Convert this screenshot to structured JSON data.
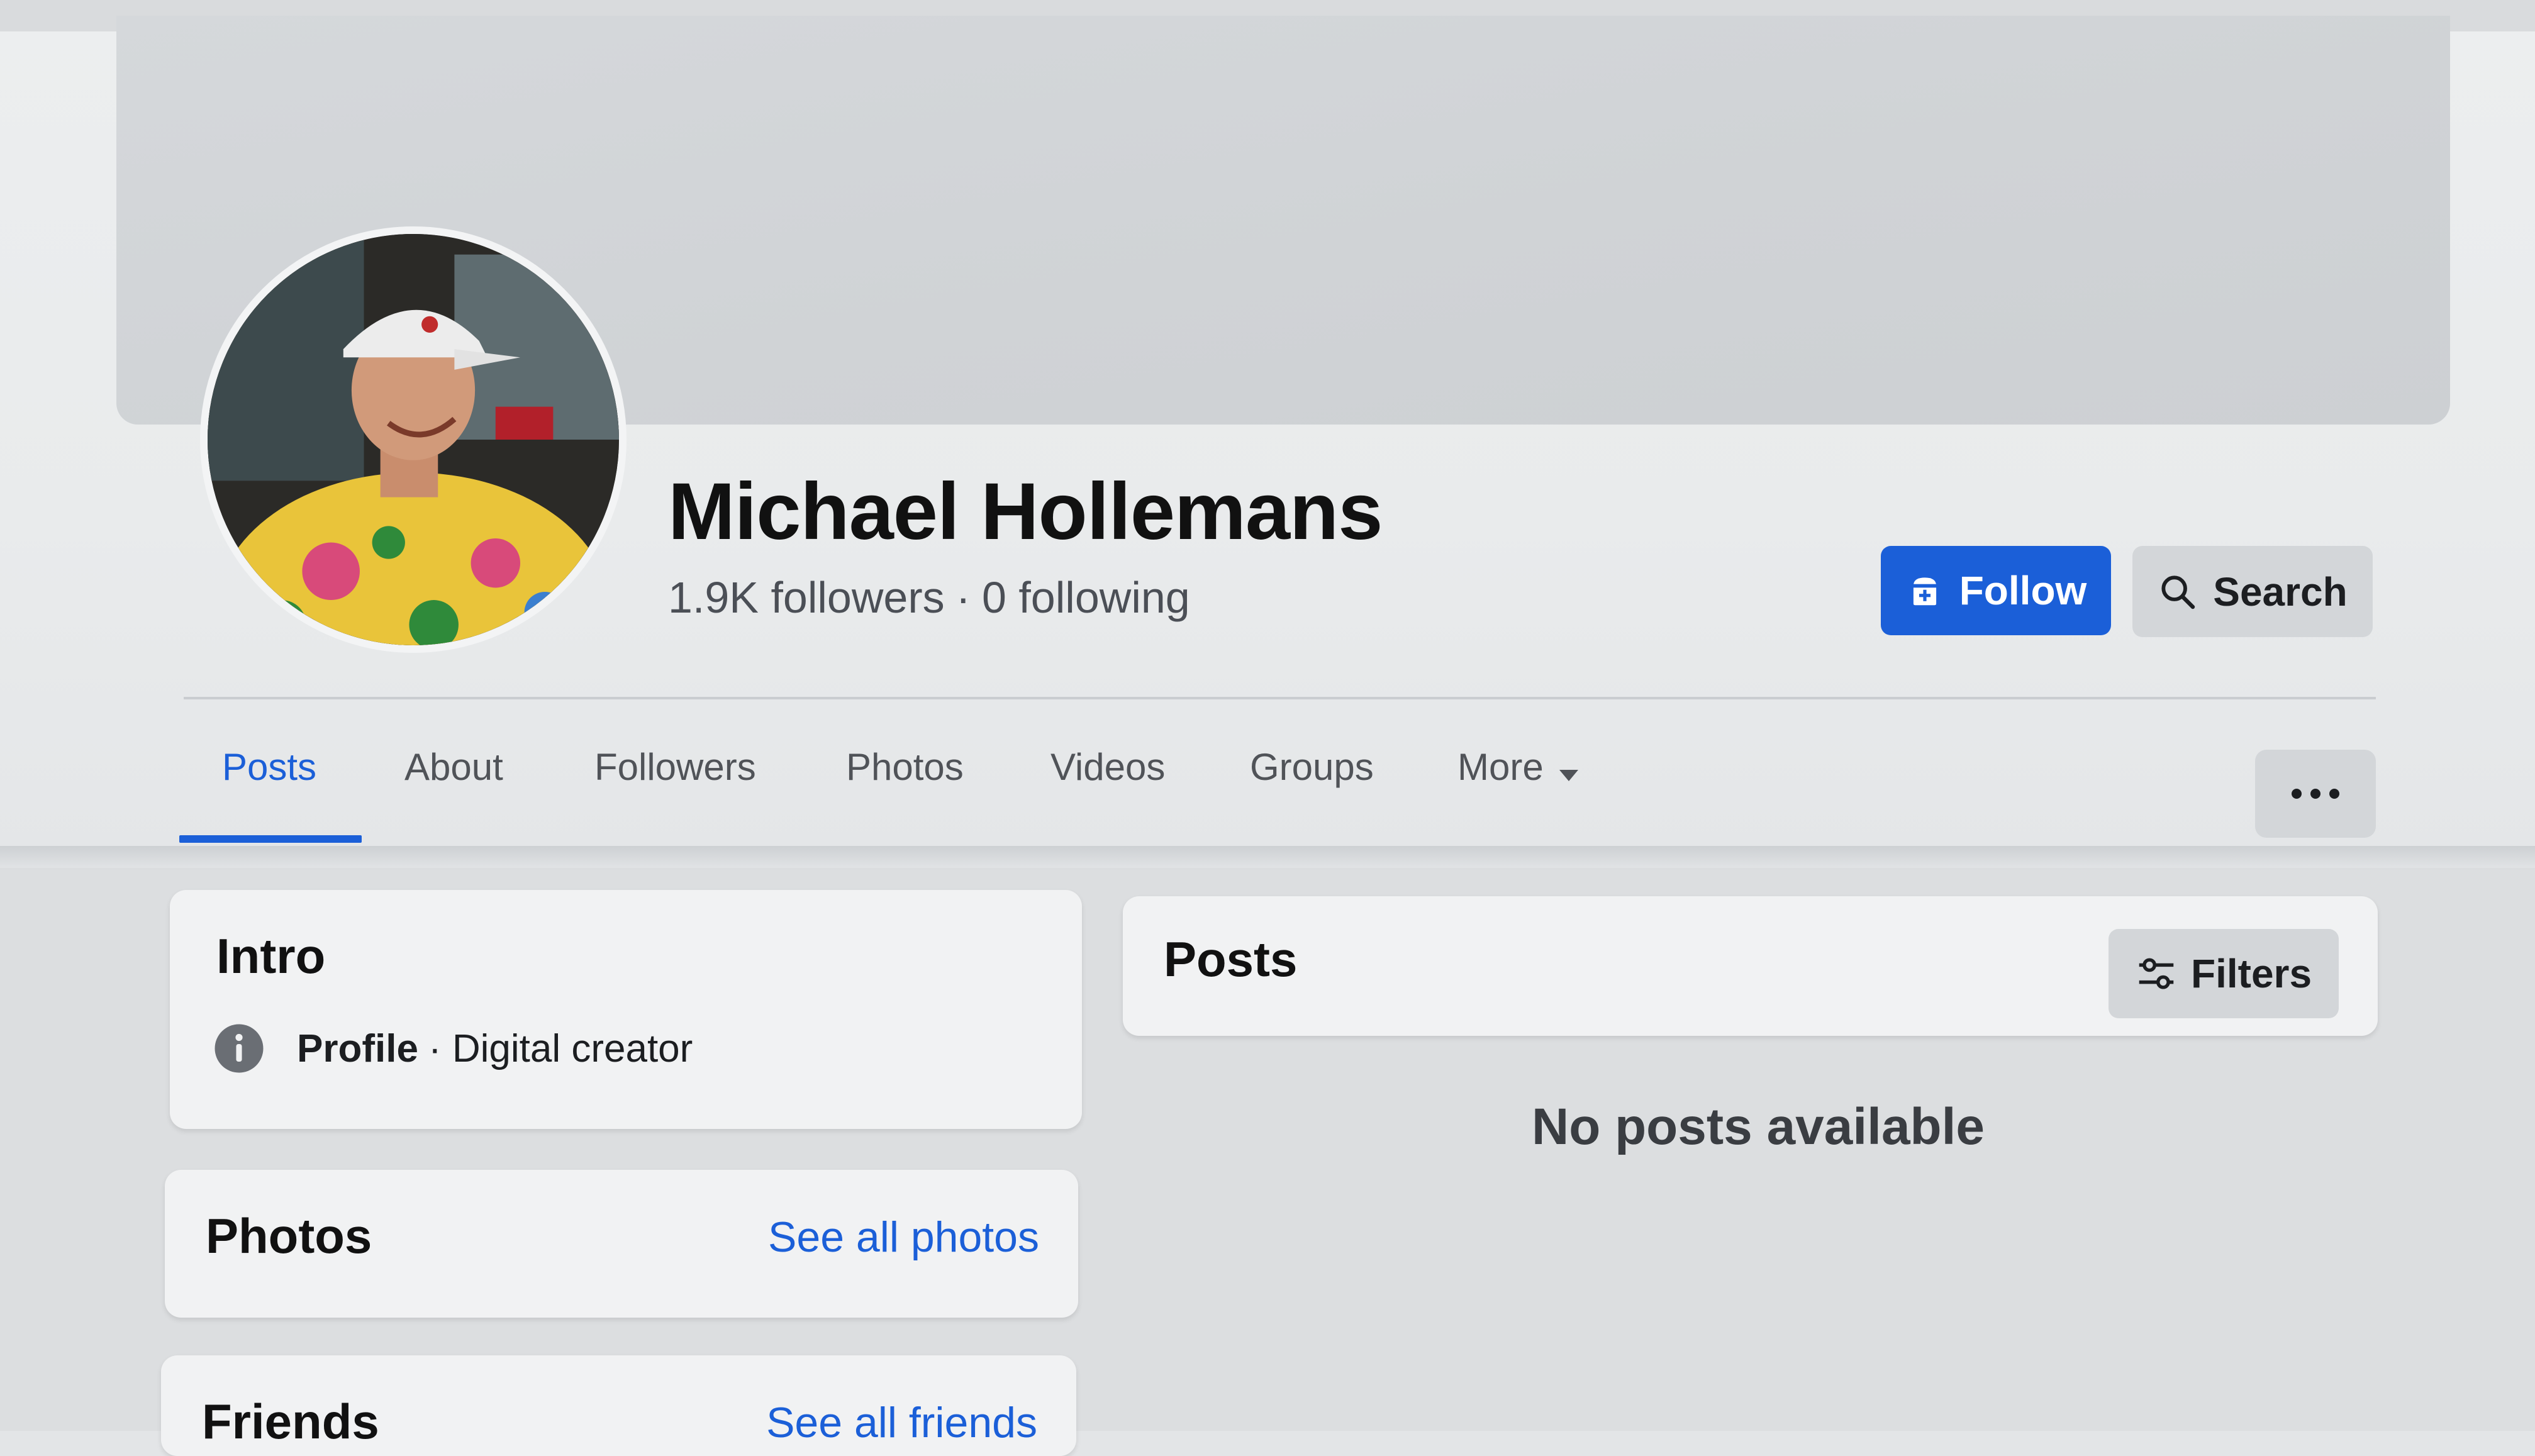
{
  "profile": {
    "name": "Michael Hollemans",
    "followers": "1.9K followers",
    "separator": "·",
    "following": "0 following"
  },
  "actions": {
    "follow_label": "Follow",
    "search_label": "Search"
  },
  "tabs": [
    {
      "label": "Posts",
      "active": true
    },
    {
      "label": "About"
    },
    {
      "label": "Followers"
    },
    {
      "label": "Photos"
    },
    {
      "label": "Videos"
    },
    {
      "label": "Groups"
    },
    {
      "label": "More"
    }
  ],
  "intro": {
    "title": "Intro",
    "category_label": "Profile",
    "category_sep": "·",
    "category_value": "Digital creator"
  },
  "photos": {
    "title": "Photos",
    "link": "See all photos"
  },
  "friends": {
    "title": "Friends",
    "link": "See all friends"
  },
  "posts": {
    "title": "Posts",
    "filters_label": "Filters",
    "empty_text": "No posts available"
  },
  "colors": {
    "accent": "#1b5fd8",
    "secondary_button": "#d3d6d9",
    "card": "#f1f2f3"
  },
  "icons": {
    "follow": "follow-add-icon",
    "search": "search-icon",
    "more_caret": "caret-down-icon",
    "more_menu": "ellipsis-icon",
    "intro_info": "info-icon",
    "filters": "sliders-icon"
  }
}
